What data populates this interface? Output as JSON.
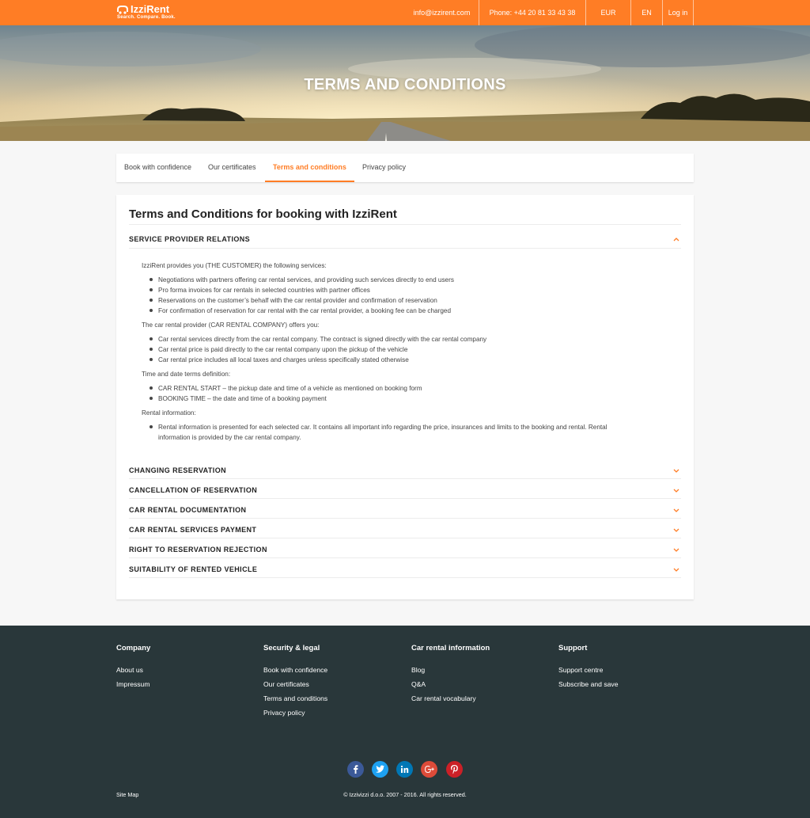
{
  "header": {
    "logo_name": "IzziRent",
    "logo_tagline": "Search. Compare. Book.",
    "email": "info@izzirent.com",
    "phone": "Phone: +44 20 81 33 43 38",
    "currency": "EUR",
    "language": "EN",
    "login": "Log in"
  },
  "hero": {
    "title": "TERMS AND CONDITIONS"
  },
  "tabs": [
    {
      "label": "Book with confidence"
    },
    {
      "label": "Our certificates"
    },
    {
      "label": "Terms and conditions"
    },
    {
      "label": "Privacy policy"
    }
  ],
  "card": {
    "title": "Terms and Conditions for booking with IzziRent",
    "open_section": {
      "title": "SERVICE PROVIDER RELATIONS",
      "intro_1": "IzziRent provides you (THE CUSTOMER) the following services:",
      "list_1": [
        "Negotiations with partners offering car rental services, and providing such services directly to end users",
        "Pro forma invoices for car rentals in selected countries with partner offices",
        "Reservations on the customer’s behalf with the car rental provider and confirmation of reservation",
        "For confirmation of reservation for car rental with the car rental provider, a booking fee can be charged"
      ],
      "intro_2": "The car rental provider (CAR RENTAL COMPANY) offers you:",
      "list_2": [
        "Car rental services directly from the car rental company. The contract is signed directly with the car rental company",
        "Car rental price is paid directly to the car rental company upon the pickup of the vehicle",
        "Car rental price includes all local taxes and charges unless specifically stated otherwise"
      ],
      "intro_3": "Time and date terms definition:",
      "list_3": [
        "CAR RENTAL START – the pickup date and time of a vehicle as mentioned on booking form",
        "BOOKING TIME – the date and time of a booking payment"
      ],
      "intro_4": "Rental information:",
      "list_4_line1": "Rental information is presented for each selected car. It contains all important info regarding the price, insurances and limits to the booking and rental. Rental",
      "list_4_line2": "information is provided by the car rental company."
    },
    "collapsed_sections": [
      "CHANGING RESERVATION",
      "CANCELLATION OF RESERVATION",
      "CAR RENTAL DOCUMENTATION",
      "CAR RENTAL SERVICES PAYMENT",
      "RIGHT TO RESERVATION REJECTION",
      "SUITABILITY OF RENTED VEHICLE"
    ]
  },
  "footer": {
    "columns": [
      {
        "title": "Company",
        "links": [
          "About us",
          "Impressum"
        ]
      },
      {
        "title": "Security & legal",
        "links": [
          "Book with confidence",
          "Our certificates",
          "Terms and conditions",
          "Privacy policy"
        ]
      },
      {
        "title": "Car rental information",
        "links": [
          "Blog",
          "Q&A",
          "Car rental vocabulary"
        ]
      },
      {
        "title": "Support",
        "links": [
          "Support centre",
          "Subscribe and save"
        ]
      }
    ],
    "social": [
      {
        "icon": "facebook-icon",
        "color": "#3b5998"
      },
      {
        "icon": "twitter-icon",
        "color": "#1da1f2"
      },
      {
        "icon": "linkedin-icon",
        "color": "#0077b5"
      },
      {
        "icon": "google-plus-icon",
        "color": "#dd4b39"
      },
      {
        "icon": "pinterest-icon",
        "color": "#cb2027"
      }
    ],
    "sitemap": "Site Map",
    "copyright": "© Izzivizzi d.o.o. 2007 - 2016. All rights reserved."
  },
  "colors": {
    "accent": "#ff7d25",
    "footer_bg": "#29373a"
  }
}
